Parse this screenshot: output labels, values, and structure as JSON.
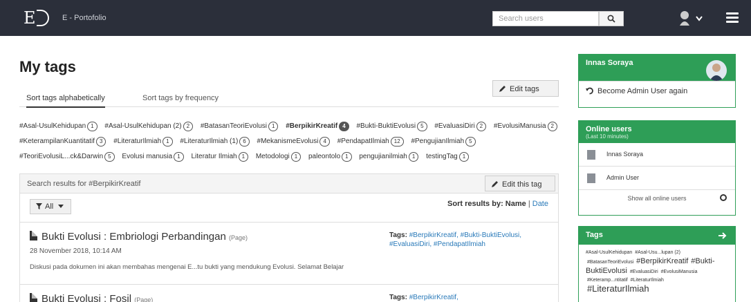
{
  "header": {
    "logo": "E",
    "brand": "E - Portofolio",
    "search_placeholder": "Search users"
  },
  "page": {
    "title": "My tags",
    "edit_tags": "Edit tags",
    "tabs": [
      "Sort tags alphabetically",
      "Sort tags by frequency"
    ]
  },
  "tag_cloud": [
    {
      "label": "#Asal-UsulKehidupan",
      "count": "1"
    },
    {
      "label": "#Asal-UsulKehidupan (2)",
      "count": "2"
    },
    {
      "label": "#BatasanTeoriEvolusi",
      "count": "1"
    },
    {
      "label": "#BerpikirKreatif",
      "count": "4",
      "active": true
    },
    {
      "label": "#Bukti-BuktiEvolusi",
      "count": "5"
    },
    {
      "label": "#EvaluasiDiri",
      "count": "2"
    },
    {
      "label": "#EvolusiManusia",
      "count": "2"
    },
    {
      "label": "#KeterampilanKuantitatif",
      "count": "3"
    },
    {
      "label": "#LiteraturIlmiah",
      "count": "1"
    },
    {
      "label": "#LiteraturIlmiah (1)",
      "count": "6"
    },
    {
      "label": "#MekanismeEvolusi",
      "count": "4"
    },
    {
      "label": "#PendapatIlmiah",
      "count": "12"
    },
    {
      "label": "#PengujianIlmiah",
      "count": "5"
    },
    {
      "label": "#TeoriEvolusiL...ck&Darwin",
      "count": "5"
    },
    {
      "label": "Evolusi manusia",
      "count": "1"
    },
    {
      "label": "Literatur Ilmiah",
      "count": "1"
    },
    {
      "label": "Metodologi",
      "count": "1"
    },
    {
      "label": "paleontolo",
      "count": "1"
    },
    {
      "label": "pengujianilmiah",
      "count": "1"
    },
    {
      "label": "testingTag",
      "count": "1"
    }
  ],
  "results": {
    "heading": "Search results for #BerpikirKreatif",
    "edit_this_tag": "Edit this tag",
    "filter": "All",
    "sort_label": "Sort results by:",
    "sort_name": "Name",
    "sort_sep": "|",
    "sort_date": "Date",
    "items": [
      {
        "title": "Bukti Evolusi : Embriologi Perbandingan",
        "kind": "(Page)",
        "date": "28 November 2018, 10:14 AM",
        "desc": "Diskusi pada dokumen ini akan membahas mengenai E...tu bukti yang mendukung Evolusi. Selamat Belajar",
        "tags_label": "Tags:",
        "tags": "#BerpikirKreatif, #Bukti-BuktiEvolusi, #EvaluasiDiri, #PendapatIlmiah"
      },
      {
        "title": "Bukti Evolusi : Fosil",
        "kind": "(Page)",
        "tags_label": "Tags:",
        "tags": "#BerpikirKreatif,"
      }
    ]
  },
  "sidebar": {
    "user_name": "Innas Soraya",
    "become_admin": "Become Admin User again",
    "online_title": "Online users",
    "online_sub": "(Last 10 minutes)",
    "online_users": [
      "Innas Soraya",
      "Admin User"
    ],
    "show_all": "Show all online users",
    "tags_title": "Tags",
    "tags": [
      {
        "label": "#Asal-UsulKehidupan",
        "size": "s"
      },
      {
        "label": "#Asal-Usu...lupan (2)",
        "size": "s"
      },
      {
        "label": "#BatasanTeoriEvolusi",
        "size": "s"
      },
      {
        "label": "#BerpikirKreatif",
        "size": "lg"
      },
      {
        "label": "#Bukti-BuktiEvolusi",
        "size": "lg"
      },
      {
        "label": "#EvaluasiDiri",
        "size": "s"
      },
      {
        "label": "#EvolusiManusia",
        "size": "s"
      },
      {
        "label": "#Keteramp...ntitatif",
        "size": "s"
      },
      {
        "label": "#LiteraturIlmiah",
        "size": "s"
      },
      {
        "label": "#LiteraturIlmiah",
        "size": "xl"
      }
    ]
  },
  "colors": {
    "navbar": "#2b2f3a",
    "accent": "#2e9e57",
    "link": "#2a7ab9"
  }
}
